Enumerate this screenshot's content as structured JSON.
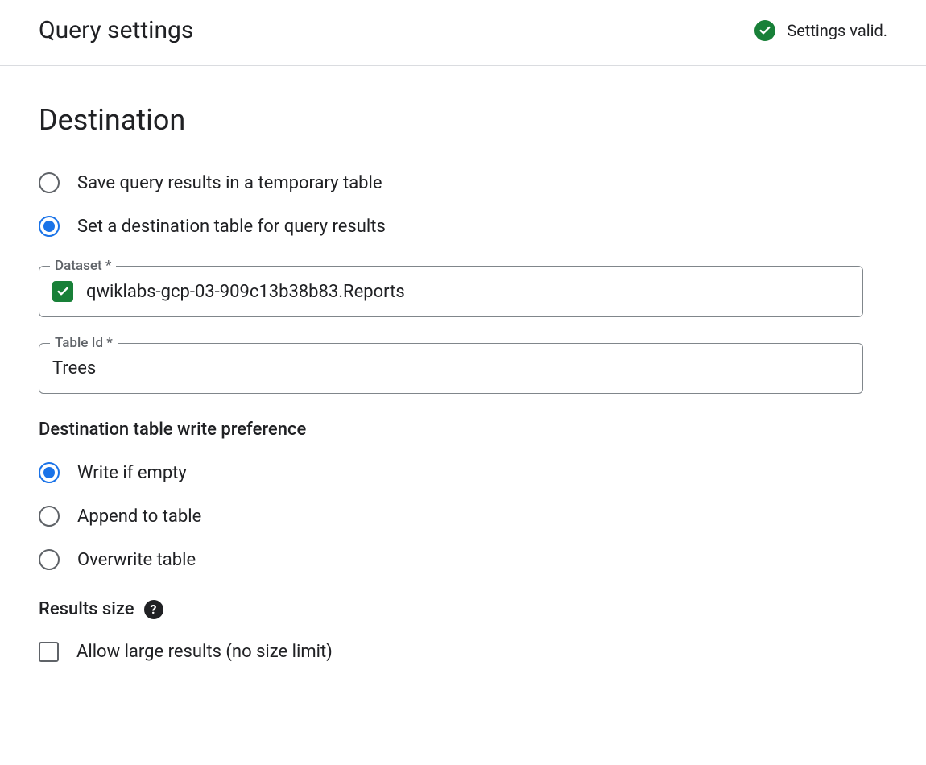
{
  "header": {
    "title": "Query settings",
    "status_text": "Settings valid."
  },
  "destination": {
    "title": "Destination",
    "radios": [
      {
        "label": "Save query results in a temporary table",
        "selected": false
      },
      {
        "label": "Set a destination table for query results",
        "selected": true
      }
    ],
    "dataset": {
      "label": "Dataset *",
      "value": "qwiklabs-gcp-03-909c13b38b83.Reports",
      "validated": true
    },
    "table": {
      "label": "Table Id *",
      "value": "Trees"
    }
  },
  "write_pref": {
    "title": "Destination table write preference",
    "radios": [
      {
        "label": "Write if empty",
        "selected": true
      },
      {
        "label": "Append to table",
        "selected": false
      },
      {
        "label": "Overwrite table",
        "selected": false
      }
    ]
  },
  "results_size": {
    "title": "Results size",
    "checkbox_label": "Allow large results (no size limit)",
    "checked": false
  }
}
